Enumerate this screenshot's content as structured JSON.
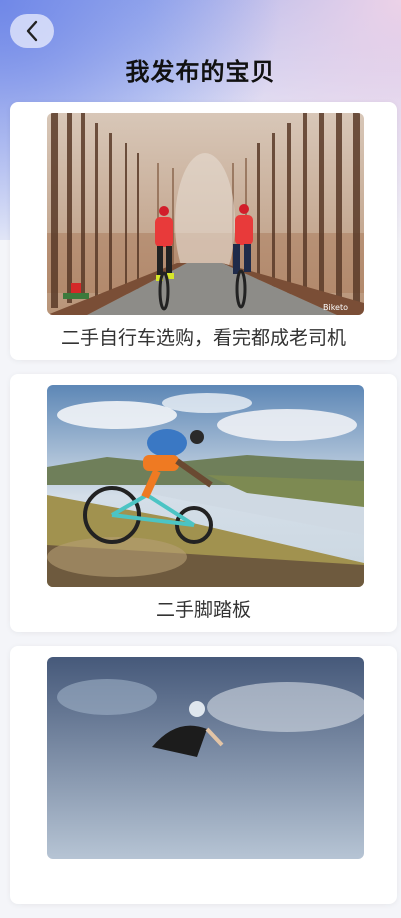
{
  "header": {
    "title": "我发布的宝贝"
  },
  "items": [
    {
      "label": "二手自行车选购，看完都成老司机",
      "watermark": "Biketo"
    },
    {
      "label": "二手脚踏板"
    },
    {
      "label": ""
    }
  ],
  "colors": {
    "accent_gradient_start": "#7088e8",
    "accent_gradient_end": "#ecd2e8",
    "card_bg": "#ffffff",
    "page_bg": "#f4f5f9"
  }
}
